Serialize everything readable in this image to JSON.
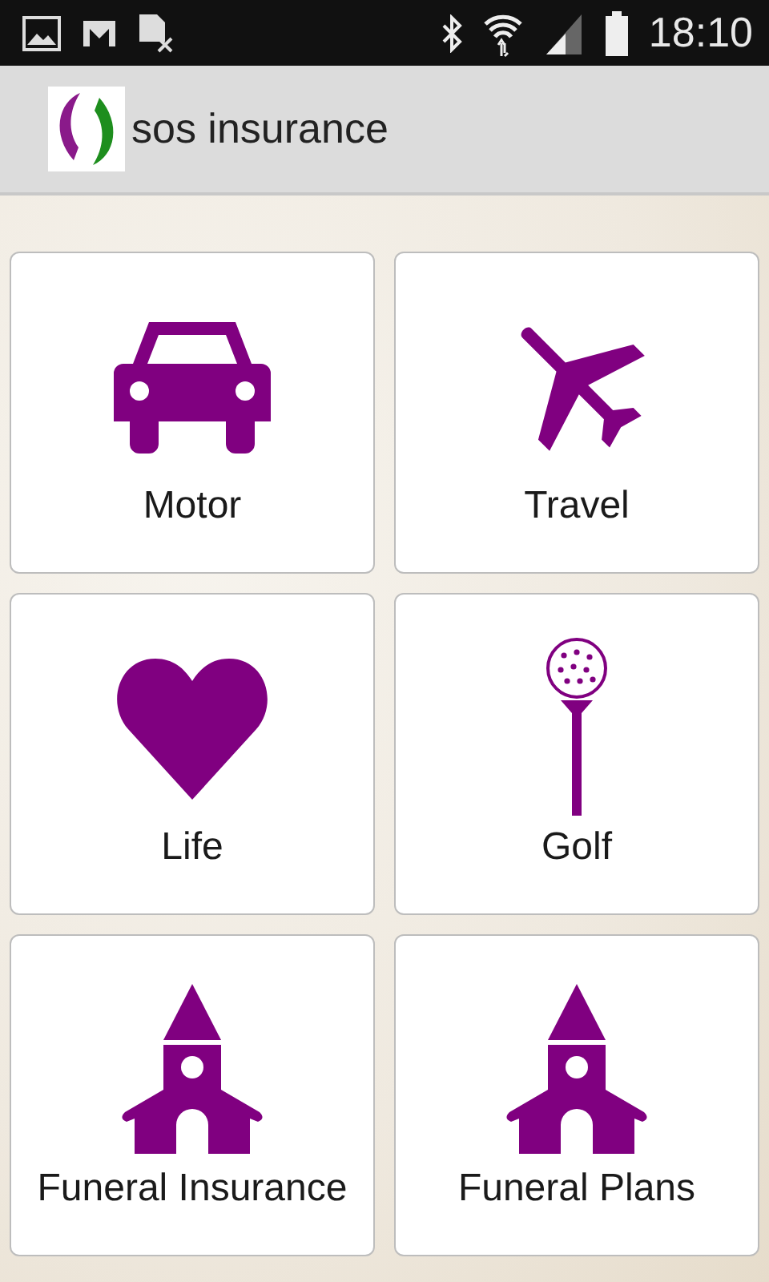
{
  "status_bar": {
    "time": "18:10"
  },
  "app_bar": {
    "title": "sos insurance"
  },
  "tiles": [
    {
      "kind": "car",
      "label": "Motor"
    },
    {
      "kind": "plane",
      "label": "Travel"
    },
    {
      "kind": "heart",
      "label": "Life"
    },
    {
      "kind": "golf",
      "label": "Golf"
    },
    {
      "kind": "church",
      "label": "Funeral Insurance"
    },
    {
      "kind": "church",
      "label": "Funeral Plans"
    }
  ]
}
